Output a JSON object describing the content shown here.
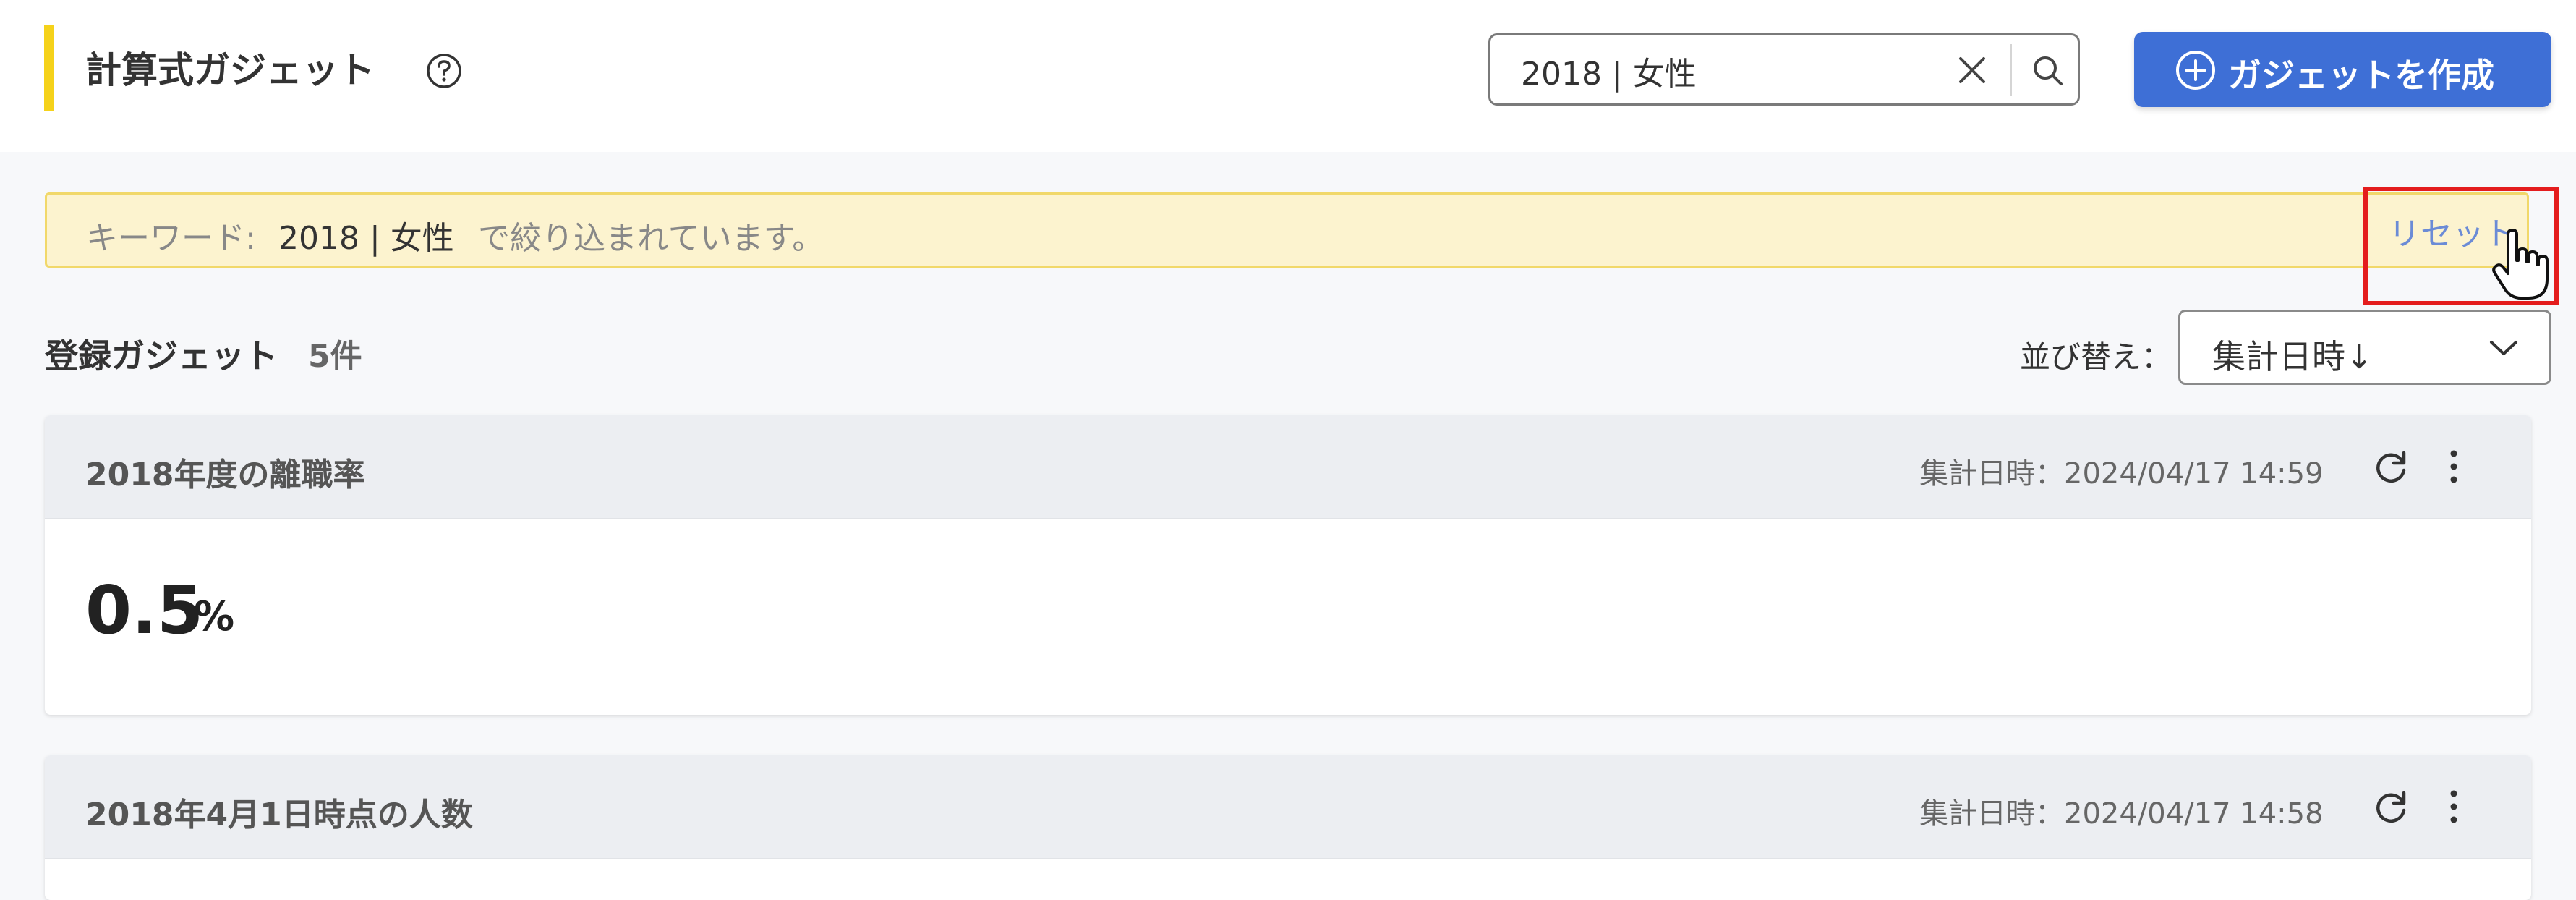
{
  "header": {
    "title": "計算式ガジェット",
    "help_icon": "question-circle-icon",
    "search": {
      "value": "2018 | 女性",
      "placeholder": ""
    },
    "create_button": {
      "label": "ガジェットを作成",
      "icon": "plus-circle-icon"
    }
  },
  "filter": {
    "prefix": "キーワード:",
    "keyword": "2018 | 女性",
    "suffix": "で絞り込まれています。",
    "reset_label": "リセット"
  },
  "list": {
    "title": "登録ガジェット",
    "count": "5件",
    "sort_label": "並び替え：",
    "sort_value": "集計日時↓"
  },
  "cards": [
    {
      "title": "2018年度の離職率",
      "date": "集計日時：2024/04/17 14:59",
      "value": "0.5",
      "unit": "%"
    },
    {
      "title": "2018年4月1日時点の人数",
      "date": "集計日時：2024/04/17 14:58"
    }
  ],
  "colors": {
    "accent_bar": "#f5d21a",
    "primary_button": "#3e6fd6",
    "banner_bg": "#fcf3cf",
    "link": "#6b8bd6",
    "highlight": "#e41d1d"
  }
}
